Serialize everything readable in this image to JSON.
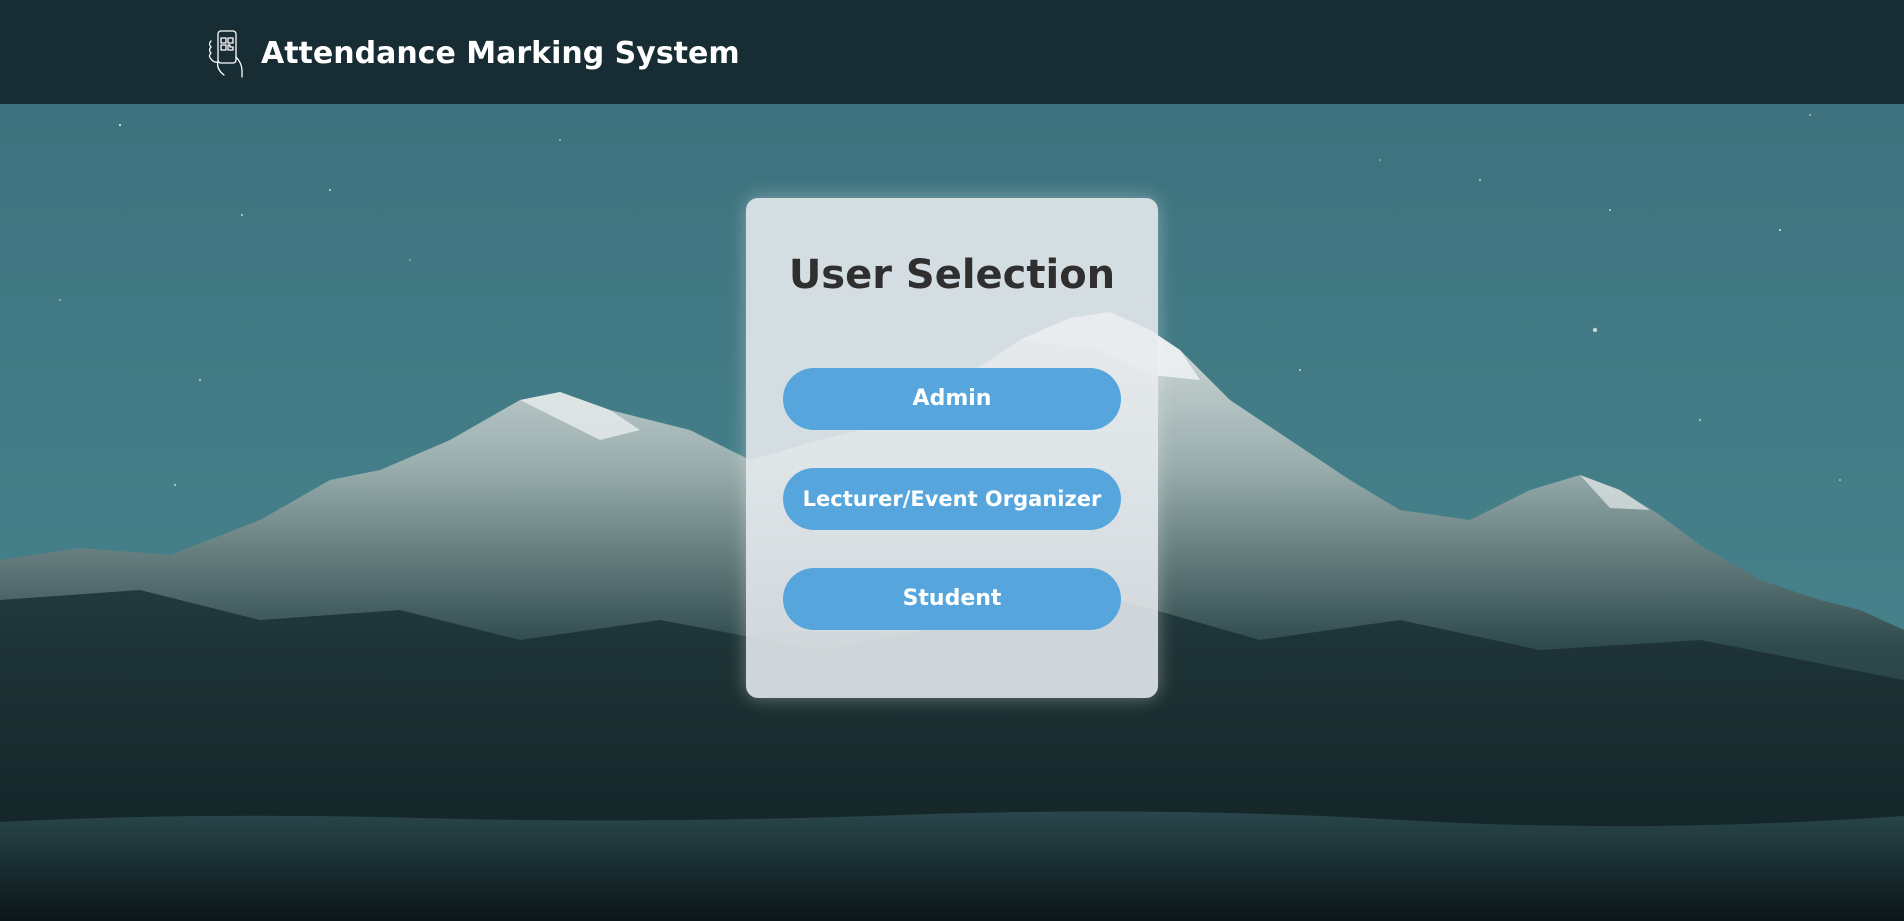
{
  "header": {
    "title": "Attendance Marking System",
    "logo_icon": "phone-qr-hand-icon"
  },
  "selection_card": {
    "title": "User Selection",
    "buttons": [
      {
        "label": "Admin"
      },
      {
        "label": "Lecturer/Event Organizer"
      },
      {
        "label": "Student"
      }
    ]
  },
  "colors": {
    "header_bg": "#172c33",
    "button_bg": "#56a6dd",
    "button_text": "#ffffff",
    "card_bg": "#e8ecef",
    "title_text": "#2f2f2f"
  }
}
